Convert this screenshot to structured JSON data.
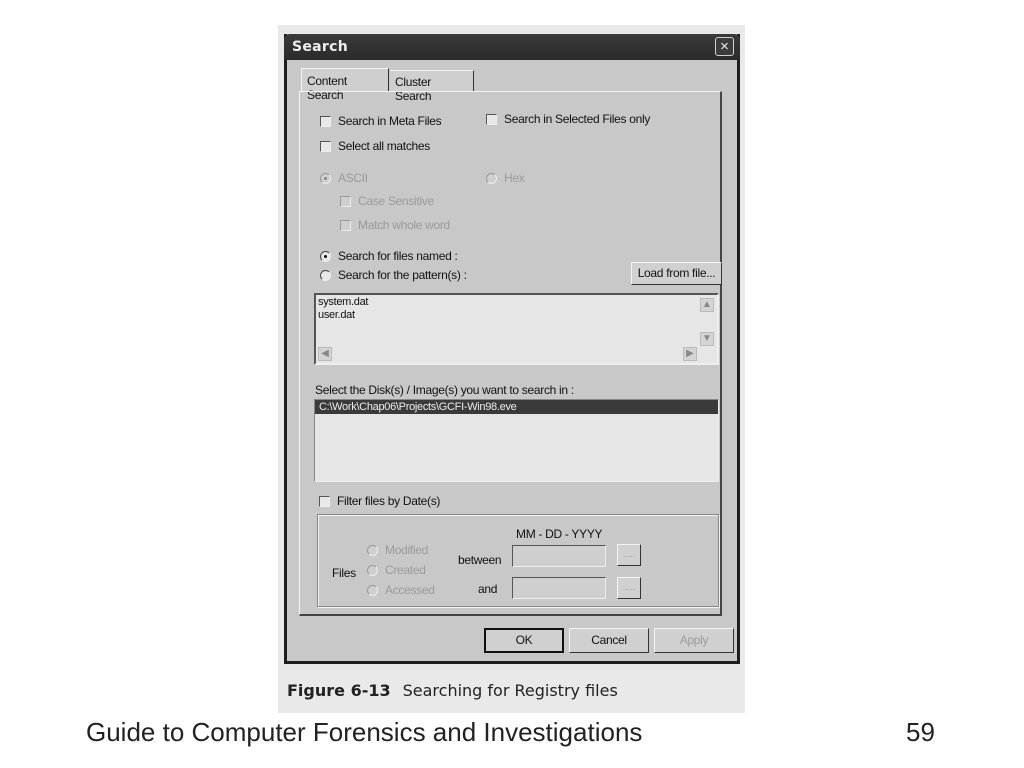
{
  "dialog": {
    "title": "Search",
    "close_icon": "×",
    "tabs": [
      {
        "label": "Content Search",
        "active": true
      },
      {
        "label": "Cluster Search",
        "active": false
      }
    ],
    "options": {
      "search_meta_files": {
        "label": "Search in Meta Files",
        "checked": false
      },
      "search_selected_only": {
        "label": "Search in Selected Files only",
        "checked": false
      },
      "select_all_matches": {
        "label": "Select all matches",
        "checked": false
      }
    },
    "encoding": {
      "ascii": {
        "label": "ASCII",
        "selected": true,
        "enabled": false
      },
      "hex": {
        "label": "Hex",
        "selected": false,
        "enabled": false
      },
      "case_sensitive": {
        "label": "Case Sensitive",
        "checked": false,
        "enabled": false
      },
      "match_whole_word": {
        "label": "Match whole word",
        "checked": false,
        "enabled": false
      }
    },
    "mode": {
      "files_named": {
        "label": "Search for files named  :",
        "selected": true
      },
      "pattern": {
        "label": "Search for the pattern(s)  :",
        "selected": false
      }
    },
    "load_from_file_label": "Load from file...",
    "search_terms": [
      "system.dat",
      "user.dat"
    ],
    "scroll_icons": {
      "up": "▲",
      "down": "▼",
      "left": "◀",
      "right": "▶"
    },
    "disk_label": "Select the Disk(s) / Image(s) you want to search in  :",
    "disks": [
      {
        "path": "C:\\Work\\Chap06\\Projects\\GCFI-Win98.eve",
        "selected": true
      }
    ],
    "date_filter": {
      "label": "Filter files by Date(s)",
      "checked": false,
      "format_label": "MM - DD - YYYY",
      "files_label": "Files",
      "between_label": "between",
      "and_label": "and",
      "between_value": "",
      "and_value": "",
      "picker_label": ".....",
      "types": [
        {
          "label": "Modified",
          "selected": false
        },
        {
          "label": "Created",
          "selected": false
        },
        {
          "label": "Accessed",
          "selected": false
        }
      ]
    },
    "buttons": {
      "ok": "OK",
      "cancel": "Cancel",
      "apply": "Apply"
    }
  },
  "caption": {
    "figure_number": "Figure 6-13",
    "text": "Searching for Registry files"
  },
  "footer": {
    "title": "Guide to Computer Forensics and Investigations",
    "page_number": "59"
  }
}
